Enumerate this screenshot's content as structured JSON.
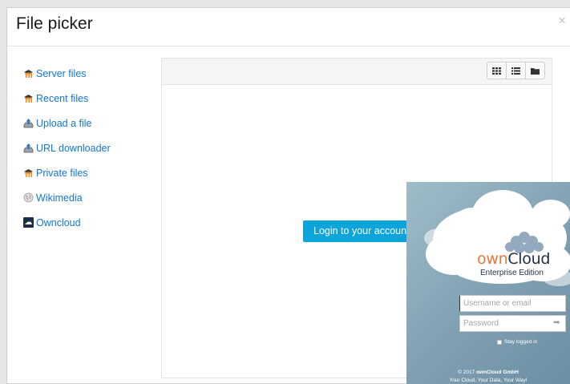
{
  "dialog": {
    "title": "File picker",
    "close_label": "×"
  },
  "sidebar": {
    "items": [
      {
        "label": "Server files",
        "icon": "moodle-icon"
      },
      {
        "label": "Recent files",
        "icon": "moodle-icon"
      },
      {
        "label": "Upload a file",
        "icon": "upload-icon"
      },
      {
        "label": "URL downloader",
        "icon": "url-downloader-icon"
      },
      {
        "label": "Private files",
        "icon": "moodle-icon"
      },
      {
        "label": "Wikimedia",
        "icon": "wikimedia-icon"
      },
      {
        "label": "Owncloud",
        "icon": "owncloud-icon"
      }
    ]
  },
  "toolbar": {
    "views": [
      "icon-view",
      "list-view",
      "tree-view"
    ]
  },
  "main": {
    "login_button": "Login to your account"
  },
  "owncloud": {
    "brand_own": "own",
    "brand_cloud": "Cloud",
    "edition": "Enterprise Edition",
    "username_placeholder": "Username or email",
    "password_placeholder": "Password",
    "submit_icon": "➡",
    "stay_logged_in": "Stay logged in",
    "copyright_prefix": "© 2017 ",
    "copyright_company": "ownCloud GmbH",
    "slogan": "Your Cloud, Your Data, Your Way!"
  },
  "colors": {
    "link": "#1177d1",
    "login_button": "#0ca5db",
    "owncloud_orange": "#e8783a",
    "owncloud_navy": "#1d2d44"
  }
}
